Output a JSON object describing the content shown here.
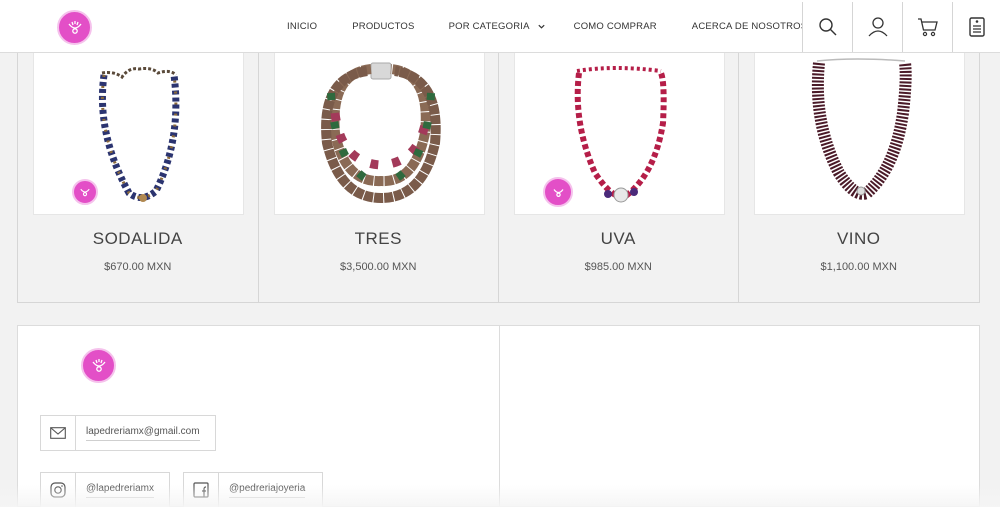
{
  "colors": {
    "brand": "#e34fc7",
    "brand_light": "#f5c2ec"
  },
  "header": {
    "logo_icon": "brand-logo-icon",
    "nav": [
      {
        "label": "INICIO"
      },
      {
        "label": "PRODUCTOS"
      },
      {
        "label": "POR CATEGORIA",
        "has_dropdown": true
      },
      {
        "label": "COMO COMPRAR"
      },
      {
        "label": "ACERCA DE NOSOTROS"
      }
    ],
    "icons": [
      "search-icon",
      "account-icon",
      "cart-icon",
      "order-list-icon"
    ]
  },
  "products": [
    {
      "name": "SODALIDA",
      "price": "$670.00 MXN",
      "badge": true
    },
    {
      "name": "TRES",
      "price": "$3,500.00 MXN",
      "badge": false
    },
    {
      "name": "UVA",
      "price": "$985.00 MXN",
      "badge": true
    },
    {
      "name": "VINO",
      "price": "$1,100.00 MXN",
      "badge": false
    }
  ],
  "footer": {
    "email": "lapedreriamx@gmail.com",
    "instagram": "@lapedreriamx",
    "facebook": "@pedreriajoyeria"
  }
}
